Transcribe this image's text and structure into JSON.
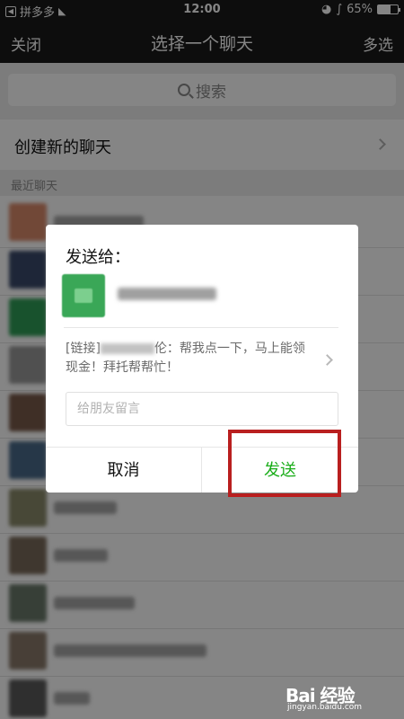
{
  "status_bar": {
    "carrier": "拼多多",
    "time": "12:00",
    "battery": "65%",
    "battery_level": 0.65,
    "back_icon": "back-to-app-icon",
    "wifi_icon": "wifi-icon",
    "lock_icon": "rotation-lock-icon",
    "bluetooth_icon": "bluetooth-icon"
  },
  "nav": {
    "left": "关闭",
    "title": "选择一个聊天",
    "right": "多选"
  },
  "search": {
    "placeholder": "搜索",
    "icon": "search-icon"
  },
  "new_chat": {
    "label": "创建新的聊天"
  },
  "recent_label": "最近聊天",
  "chat_list": {
    "avatar_colors": [
      "#d98a6a",
      "#3b4a6b",
      "#2f9e57",
      "#9a9a9a",
      "#7a5a4a",
      "#4a6a8a",
      "#8a8a6a",
      "#7a6a5a",
      "#6a7a6a",
      "#8a7a6a",
      "#5a5a5a"
    ]
  },
  "dialog": {
    "title": "发送给：",
    "share_prefix": "[链接]",
    "share_text": "伦：帮我点一下，马上能领现金！拜托帮帮忙！",
    "message_placeholder": "给朋友留言",
    "cancel_label": "取消",
    "send_label": "发送"
  },
  "watermark": {
    "logo": "Bai 经验",
    "url": "jingyan.baidu.com"
  },
  "colors": {
    "bar_bg": "#1a1a1a",
    "accent_green": "#1aad19",
    "highlight_red": "#b91f1f"
  }
}
